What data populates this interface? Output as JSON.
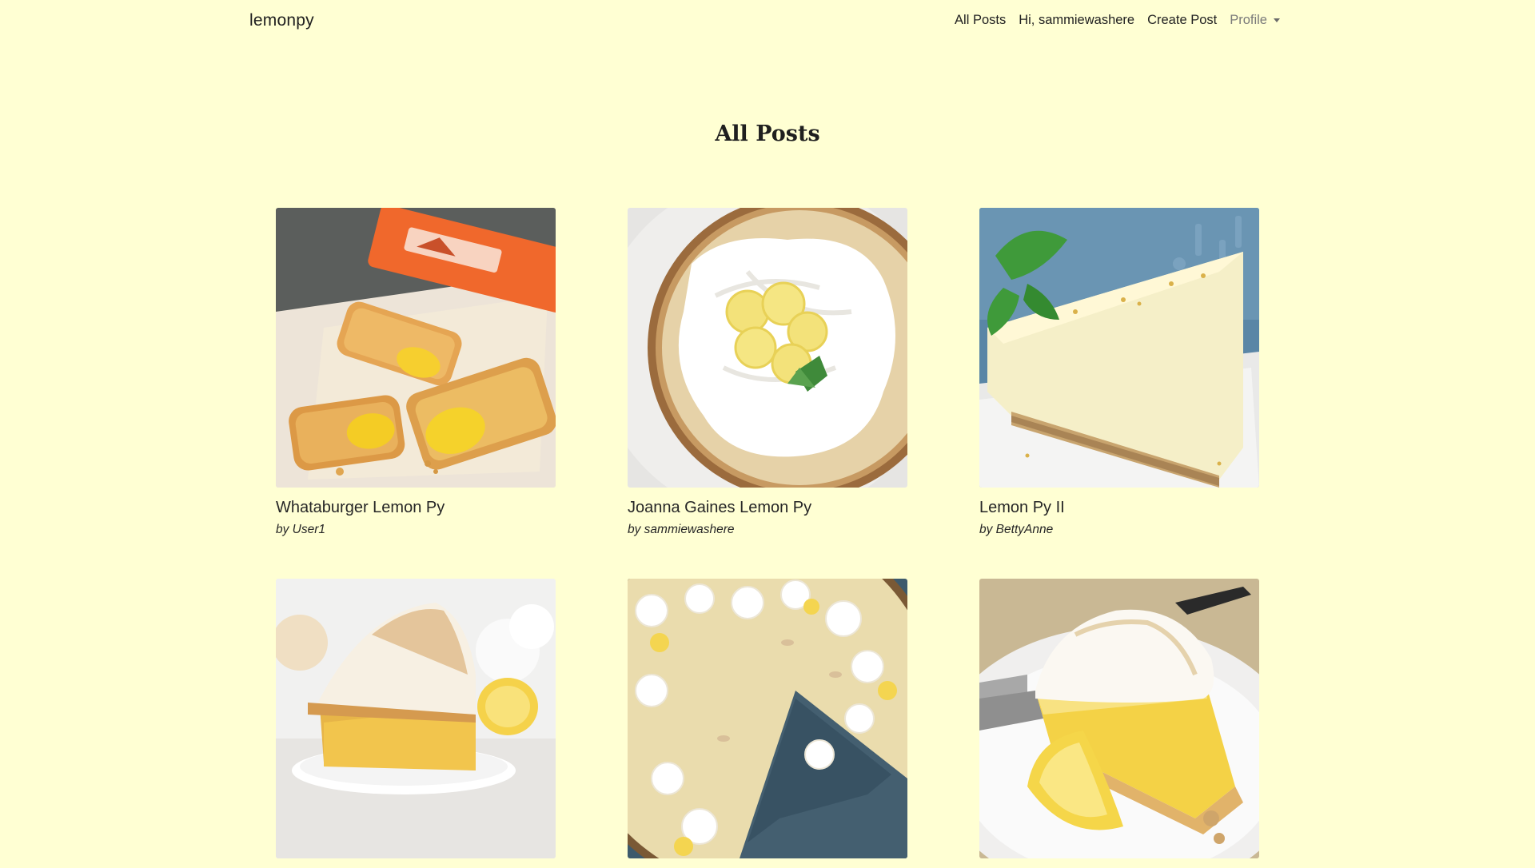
{
  "app": {
    "brand": "lemonpy"
  },
  "nav": {
    "all_posts": "All Posts",
    "greeting": "Hi, sammiewashere",
    "create_post": "Create Post",
    "profile": "Profile"
  },
  "page": {
    "title": "All Posts"
  },
  "posts": [
    {
      "title": "Whataburger Lemon Py",
      "author": "by User1"
    },
    {
      "title": "Joanna Gaines Lemon Py",
      "author": "by sammiewashere"
    },
    {
      "title": "Lemon Py II",
      "author": "by BettyAnne"
    },
    {
      "title": "",
      "author": ""
    },
    {
      "title": "",
      "author": ""
    },
    {
      "title": "",
      "author": ""
    }
  ]
}
